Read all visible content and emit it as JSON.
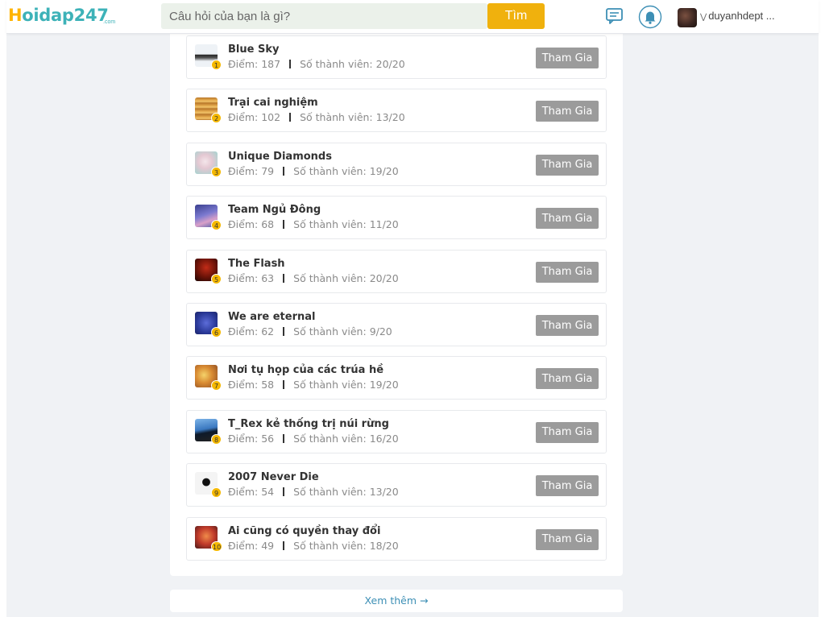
{
  "header": {
    "logo_main": "oidap247",
    "logo_h": "H",
    "logo_suffix": ".com",
    "search_placeholder": "Câu hỏi của bạn là gì?",
    "search_button": "Tìm",
    "username": "duyanhdept ..."
  },
  "groups": [
    {
      "rank": "1",
      "name": "Blue Sky",
      "points_label": "Điểm:",
      "points": "187",
      "members_label": "Số thành viên:",
      "members": "20/20",
      "join": "Tham Gia"
    },
    {
      "rank": "2",
      "name": "Trại cai nghiệm",
      "points_label": "Điểm:",
      "points": "102",
      "members_label": "Số thành viên:",
      "members": "13/20",
      "join": "Tham Gia"
    },
    {
      "rank": "3",
      "name": "Unique Diamonds",
      "points_label": "Điểm:",
      "points": "79",
      "members_label": "Số thành viên:",
      "members": "19/20",
      "join": "Tham Gia"
    },
    {
      "rank": "4",
      "name": "Team Ngủ Đông",
      "points_label": "Điểm:",
      "points": "68",
      "members_label": "Số thành viên:",
      "members": "11/20",
      "join": "Tham Gia"
    },
    {
      "rank": "5",
      "name": "The Flash",
      "points_label": "Điểm:",
      "points": "63",
      "members_label": "Số thành viên:",
      "members": "20/20",
      "join": "Tham Gia"
    },
    {
      "rank": "6",
      "name": "We are eternal",
      "points_label": "Điểm:",
      "points": "62",
      "members_label": "Số thành viên:",
      "members": "9/20",
      "join": "Tham Gia"
    },
    {
      "rank": "7",
      "name": "Nơi tụ họp của các trúa hề",
      "points_label": "Điểm:",
      "points": "58",
      "members_label": "Số thành viên:",
      "members": "19/20",
      "join": "Tham Gia"
    },
    {
      "rank": "8",
      "name": "T_Rex kẻ thống trị núi rừng",
      "points_label": "Điểm:",
      "points": "56",
      "members_label": "Số thành viên:",
      "members": "16/20",
      "join": "Tham Gia"
    },
    {
      "rank": "9",
      "name": "2007 Never Die",
      "points_label": "Điểm:",
      "points": "54",
      "members_label": "Số thành viên:",
      "members": "13/20",
      "join": "Tham Gia"
    },
    {
      "rank": "10",
      "name": "Ai cũng có quyền thay đổi",
      "points_label": "Điểm:",
      "points": "49",
      "members_label": "Số thành viên:",
      "members": "18/20",
      "join": "Tham Gia"
    }
  ],
  "see_more": "Xem thêm →",
  "colors": {
    "accent": "#f0b10d",
    "brand_teal": "#3db2b8",
    "join_button": "#9b9b9b",
    "link": "#3d8fb5",
    "badge": "#f5b800"
  },
  "icons": {
    "chat": "chat-icon",
    "bell": "bell-icon",
    "chevron": "chevron-down-icon",
    "arrow": "arrow-right-icon"
  }
}
